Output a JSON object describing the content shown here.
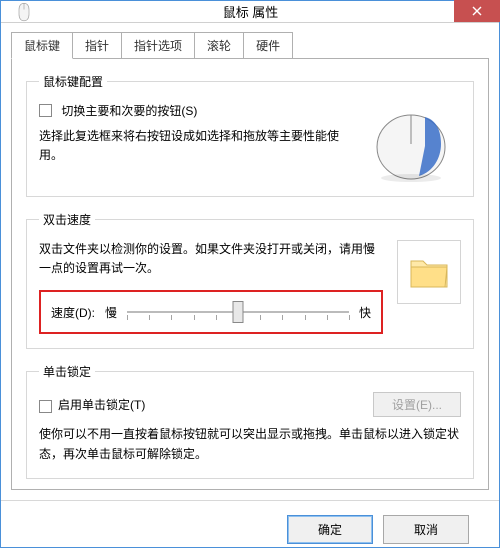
{
  "window": {
    "title": "鼠标 属性"
  },
  "tabs": {
    "t0": "鼠标键",
    "t1": "指针",
    "t2": "指针选项",
    "t3": "滚轮",
    "t4": "硬件",
    "active": 0
  },
  "groups": {
    "config": {
      "legend": "鼠标键配置",
      "checkbox_label": "切换主要和次要的按钮(S)",
      "desc": "选择此复选框来将右按钮设成如选择和拖放等主要性能使用。"
    },
    "dblclick": {
      "legend": "双击速度",
      "desc": "双击文件夹以检测你的设置。如果文件夹没打开或关闭，请用慢一点的设置再试一次。",
      "speed_label": "速度(D):",
      "slow": "慢",
      "fast": "快"
    },
    "clicklock": {
      "legend": "单击锁定",
      "checkbox_label": "启用单击锁定(T)",
      "settings_btn": "设置(E)...",
      "desc": "使你可以不用一直按着鼠标按钮就可以突出显示或拖拽。单击鼠标以进入锁定状态，再次单击鼠标可解除锁定。"
    }
  },
  "footer": {
    "ok": "确定",
    "cancel": "取消"
  }
}
